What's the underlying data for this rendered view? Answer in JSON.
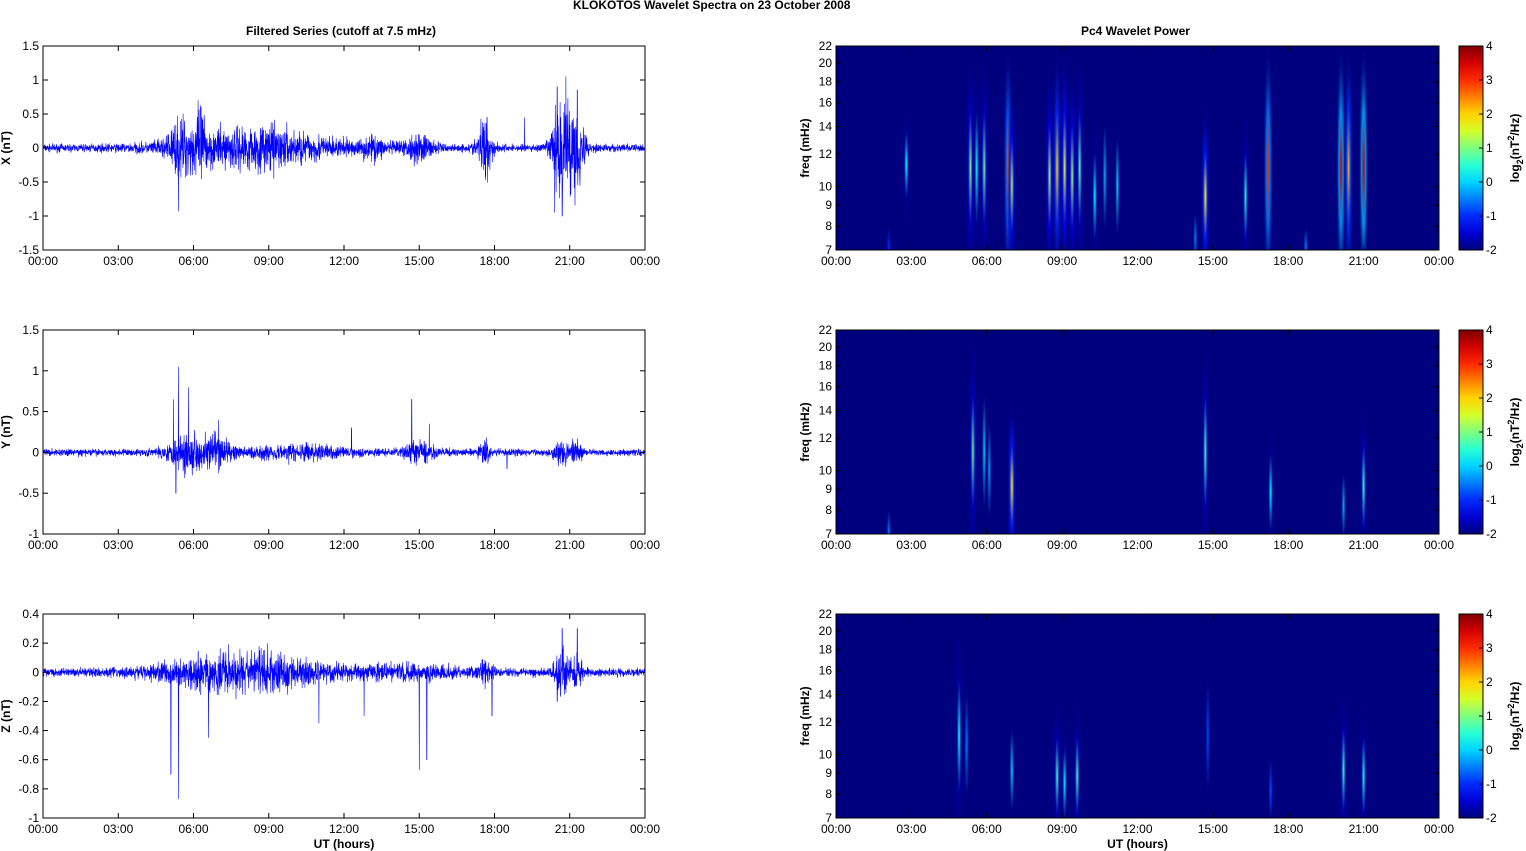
{
  "chart_data": {
    "title": "KLOKOTOS Wavelet Spectra on 23 October   2008",
    "left_title": "Filtered Series (cutoff at 7.5 mHz)",
    "right_title": "Pc4 Wavelet Power",
    "xlabel": "UT (hours)",
    "xticks": [
      "00:00",
      "03:00",
      "06:00",
      "09:00",
      "12:00",
      "15:00",
      "18:00",
      "21:00",
      "00:00"
    ],
    "xlim": [
      0,
      24
    ],
    "series": [
      {
        "name": "X",
        "type": "line",
        "ylabel": "X (nT)",
        "ylim": [
          -1.5,
          1.5
        ],
        "yticks": [
          "-1.5",
          "-1",
          "-0.5",
          "0",
          "0.5",
          "1",
          "1.5"
        ],
        "color": "#0000ff",
        "noise": 0.04,
        "bursts": [
          [
            5.5,
            0.5,
            0.2
          ],
          [
            6.3,
            0.3,
            0.25
          ],
          [
            8.5,
            3,
            0.2
          ],
          [
            13.2,
            0.6,
            0.08
          ],
          [
            15,
            0.6,
            0.12
          ],
          [
            17.6,
            0.3,
            0.3
          ],
          [
            20.7,
            0.4,
            0.5
          ],
          [
            21.3,
            0.3,
            0.45
          ]
        ],
        "spikes": [
          [
            5.4,
            -0.93
          ],
          [
            6.3,
            0.6
          ],
          [
            9.2,
            -0.45
          ],
          [
            17.7,
            0.45
          ],
          [
            19.2,
            0.45
          ],
          [
            20.5,
            0.9
          ],
          [
            20.7,
            -1.0
          ],
          [
            20.85,
            1.05
          ],
          [
            21.3,
            0.85
          ],
          [
            20.4,
            -0.95
          ]
        ]
      },
      {
        "name": "Y",
        "type": "line",
        "ylabel": "Y (nT)",
        "ylim": [
          -1,
          1.5
        ],
        "yticks": [
          "-1",
          "-0.5",
          "0",
          "0.5",
          "1",
          "1.5"
        ],
        "color": "#0000ff",
        "noise": 0.03,
        "bursts": [
          [
            5.8,
            0.8,
            0.15
          ],
          [
            7,
            0.5,
            0.12
          ],
          [
            10,
            2,
            0.05
          ],
          [
            15,
            0.6,
            0.08
          ],
          [
            17.6,
            0.2,
            0.1
          ],
          [
            20.7,
            0.3,
            0.1
          ],
          [
            21.3,
            0.2,
            0.1
          ]
        ],
        "spikes": [
          [
            5.2,
            0.65
          ],
          [
            5.4,
            1.05
          ],
          [
            5.8,
            0.8
          ],
          [
            5.3,
            -0.5
          ],
          [
            7,
            0.4
          ],
          [
            14.7,
            0.65
          ],
          [
            15.4,
            0.35
          ],
          [
            12.3,
            0.3
          ],
          [
            18.5,
            -0.2
          ]
        ]
      },
      {
        "name": "Z",
        "type": "line",
        "ylabel": "Z (nT)",
        "ylim": [
          -1,
          0.4
        ],
        "yticks": [
          "-1",
          "-0.8",
          "-0.6",
          "-0.4",
          "-0.2",
          "0",
          "0.2",
          "0.4"
        ],
        "color": "#0000ff",
        "noise": 0.02,
        "bursts": [
          [
            8,
            3,
            0.09
          ],
          [
            14.5,
            2,
            0.03
          ],
          [
            17.6,
            0.3,
            0.05
          ],
          [
            20.7,
            0.3,
            0.1
          ],
          [
            21.3,
            0.2,
            0.08
          ]
        ],
        "spikes": [
          [
            5.1,
            -0.7
          ],
          [
            5.4,
            -0.87
          ],
          [
            6.6,
            -0.45
          ],
          [
            11,
            -0.35
          ],
          [
            12.8,
            -0.3
          ],
          [
            15,
            -0.67
          ],
          [
            15.3,
            -0.6
          ],
          [
            17.9,
            -0.3
          ],
          [
            20.7,
            0.3
          ],
          [
            21.3,
            0.3
          ],
          [
            20.5,
            -0.2
          ]
        ]
      }
    ],
    "spectra": {
      "type": "heatmap",
      "ylabel": "freq (mHz)",
      "yscale": "log",
      "ylim": [
        7,
        22
      ],
      "yticks": [
        7,
        8,
        9,
        10,
        12,
        14,
        16,
        18,
        20,
        22
      ],
      "colorbar": {
        "label": "log2(nT2/Hz)",
        "range": [
          -2,
          4
        ],
        "ticks": [
          "4",
          "3",
          "2",
          "1",
          "0",
          "-1",
          "-2"
        ]
      },
      "panels": [
        {
          "name": "X",
          "events": [
            [
              2.8,
              8.5,
              15,
              0.3
            ],
            [
              2.1,
              7,
              9,
              -1
            ],
            [
              5.35,
              7,
              22,
              1
            ],
            [
              5.6,
              7,
              22,
              0.3
            ],
            [
              5.9,
              7,
              22,
              0.8
            ],
            [
              6.85,
              7,
              22,
              2.6
            ],
            [
              7.0,
              7,
              18,
              1.2
            ],
            [
              8.5,
              7,
              20,
              1.2
            ],
            [
              8.8,
              7,
              22,
              2.0
            ],
            [
              9.1,
              7,
              22,
              1.6
            ],
            [
              9.4,
              7,
              20,
              1.2
            ],
            [
              9.7,
              7,
              22,
              0.8
            ],
            [
              10.3,
              7,
              16,
              0.3
            ],
            [
              10.7,
              7,
              20,
              -0.2
            ],
            [
              11.2,
              7,
              18,
              0
            ],
            [
              14.3,
              7,
              10,
              -0.5
            ],
            [
              14.7,
              7,
              16,
              1.8
            ],
            [
              16.3,
              7,
              16,
              0.5
            ],
            [
              17.2,
              7,
              22,
              3.0
            ],
            [
              18.7,
              7,
              9,
              -0.5
            ],
            [
              20.1,
              7,
              22,
              3.5
            ],
            [
              20.4,
              7,
              22,
              2.2
            ],
            [
              21.0,
              7,
              22,
              3.6
            ]
          ]
        },
        {
          "name": "Y",
          "events": [
            [
              2.1,
              7,
              9,
              -0.5
            ],
            [
              5.45,
              7,
              22,
              0.8
            ],
            [
              5.9,
              7,
              22,
              0
            ],
            [
              6.1,
              7,
              18,
              -0.3
            ],
            [
              7.0,
              7,
              15,
              1.8
            ],
            [
              14.7,
              7,
              22,
              0.6
            ],
            [
              17.3,
              7,
              14,
              0.2
            ],
            [
              20.2,
              7,
              12,
              -0.2
            ],
            [
              21.0,
              7,
              15,
              0.6
            ]
          ]
        },
        {
          "name": "Z",
          "events": [
            [
              4.9,
              7,
              22,
              0.4
            ],
            [
              5.2,
              7,
              20,
              -0.5
            ],
            [
              7.0,
              7,
              15,
              0
            ],
            [
              8.8,
              7,
              14,
              0.6
            ],
            [
              9.1,
              7,
              13,
              0.2
            ],
            [
              9.6,
              7,
              14,
              0.6
            ],
            [
              14.8,
              7,
              22,
              -0.8
            ],
            [
              17.3,
              7,
              12,
              -0.8
            ],
            [
              20.2,
              7,
              15,
              0.6
            ],
            [
              21.0,
              7,
              14,
              0.4
            ]
          ]
        }
      ]
    }
  }
}
